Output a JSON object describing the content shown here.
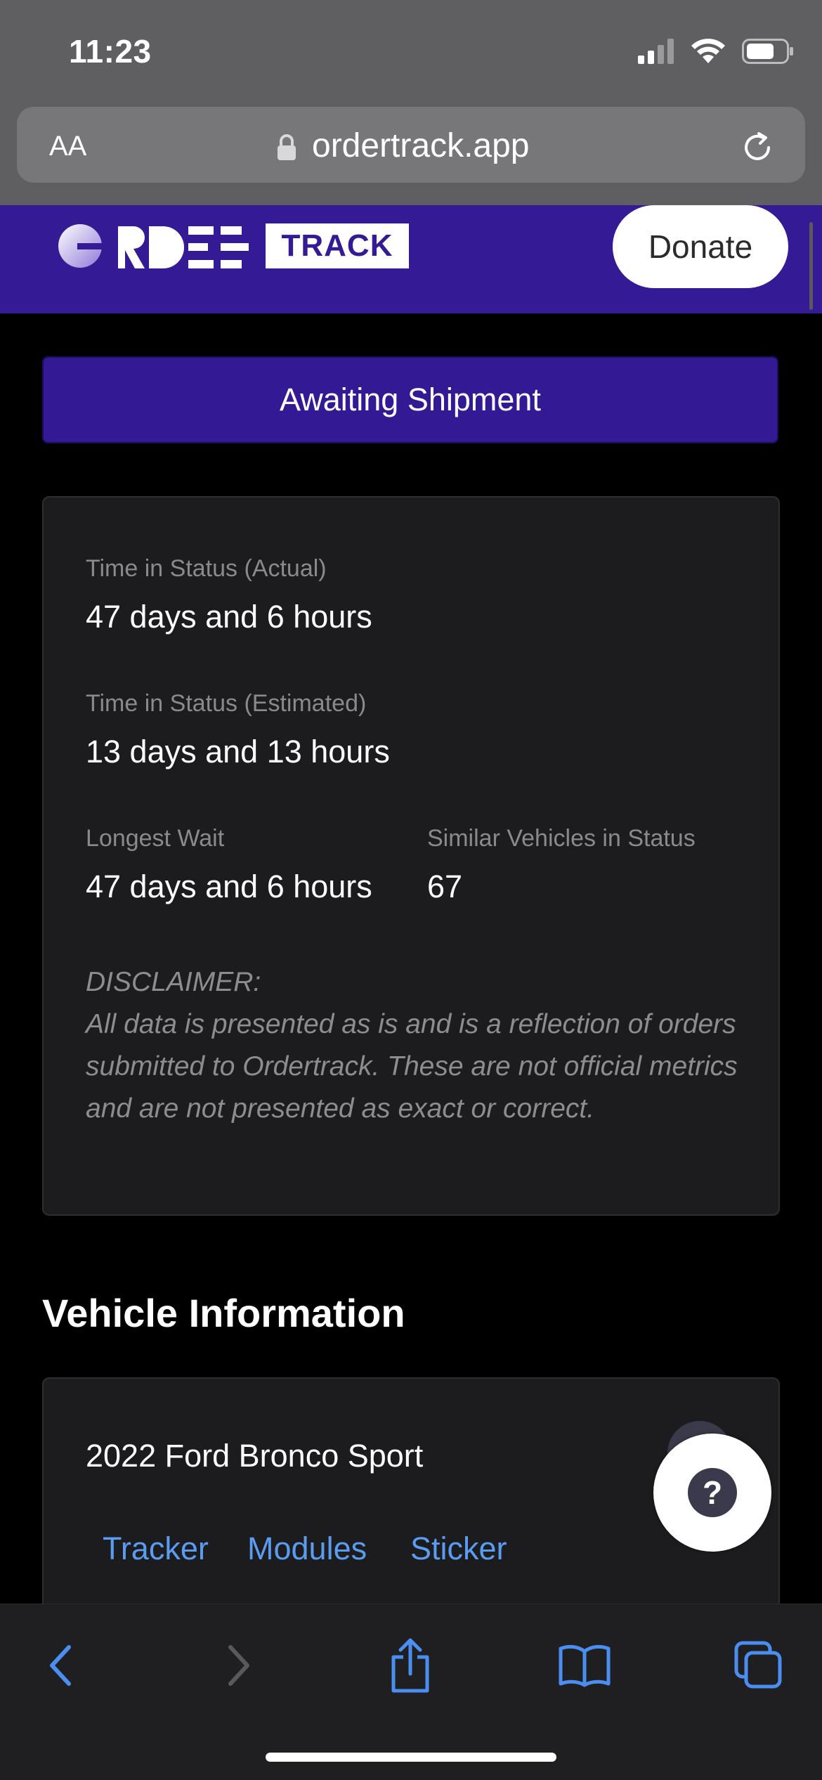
{
  "status_bar": {
    "time": "11:23"
  },
  "browser": {
    "text_size_label": "AA",
    "url": "ordertrack.app"
  },
  "site": {
    "logo_text": "ORDER",
    "logo_badge": "TRACK",
    "donate_label": "Donate"
  },
  "order_status": {
    "label": "Awaiting Shipment"
  },
  "stats": {
    "actual": {
      "label": "Time in Status (Actual)",
      "value": "47 days and 6 hours"
    },
    "estimated": {
      "label": "Time in Status (Estimated)",
      "value": "13 days and 13 hours"
    },
    "longest": {
      "label": "Longest Wait",
      "value": "47 days and 6 hours"
    },
    "similar": {
      "label": "Similar Vehicles in Status",
      "value": "67"
    },
    "disclaimer_title": "DISCLAIMER:",
    "disclaimer_text": "All data is presented as is and is a reflection of orders submitted to Ordertrack. These are not official metrics and are not presented as exact or correct."
  },
  "vehicle": {
    "section_title": "Vehicle Information",
    "name": "2022 Ford Bronco Sport",
    "links": [
      "Tracker",
      "Modules",
      "Sticker"
    ]
  },
  "help_button_label": "?"
}
